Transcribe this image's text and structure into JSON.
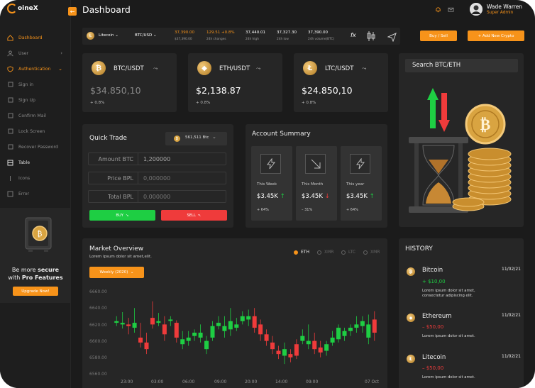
{
  "brand": {
    "name": "oineX"
  },
  "header": {
    "title": "Dashboard",
    "user_name": "Wade Warren",
    "user_role": "Super Admin"
  },
  "sidebar": {
    "items": [
      {
        "label": "Dashboard"
      },
      {
        "label": "User"
      },
      {
        "label": "Authentication"
      },
      {
        "label": "Sign in"
      },
      {
        "label": "Sign Up"
      },
      {
        "label": "Confirm Mail"
      },
      {
        "label": "Lock Screen"
      },
      {
        "label": "Recover Password"
      },
      {
        "label": "Table"
      },
      {
        "label": "Icons"
      },
      {
        "label": "Error"
      }
    ],
    "promo": {
      "line1_pre": "Be more ",
      "line1_strong": "secure",
      "line2_pre": "with ",
      "line2_strong": "Pro Features",
      "button": "Upgrade Now!"
    }
  },
  "ticker": {
    "coin": "Litecoin",
    "pair": "BTC/USD",
    "price_main": "37,390.00",
    "price_sub": "$37,390.00",
    "change_value": "129.51",
    "change_pct": "+0.8%",
    "change_label": "24h changes",
    "high": "37,440.01",
    "high_label": "24h high",
    "low": "37,327.30",
    "low_label": "24h low",
    "volume": "37,390.00",
    "volume_label": "24h volume(BTC)",
    "fx": "fx",
    "buy_sell": "Buy / Sell",
    "add_new": "+ Add New Crypto"
  },
  "coins": [
    {
      "symbol": "₿",
      "pair": "BTC/USDT",
      "price": "$34.850,10",
      "pct": "+ 0.8%",
      "muted": true
    },
    {
      "symbol": "◆",
      "pair": "ETH/USDT",
      "price": "$2,138.87",
      "pct": "+ 0.8%",
      "muted": false
    },
    {
      "symbol": "Ł",
      "pair": "LTC/USDT",
      "price": "$24.850,10",
      "pct": "+ 0.8%",
      "muted": false
    }
  ],
  "quick_trade": {
    "title": "Quick Trade",
    "select_value": "561,511 Btc",
    "rows": [
      {
        "label": "Amount BTC",
        "value": "1,200000"
      },
      {
        "label": "Price BPL",
        "value": "0,000000"
      },
      {
        "label": "Total BPL",
        "value": "0,000000"
      }
    ],
    "buy": "BUY",
    "sell": "SELL"
  },
  "account_summary": {
    "title": "Account Summary",
    "boxes": [
      {
        "label": "This Week",
        "value": "$3.45K",
        "arrow": "↑",
        "pct": "+ 64%"
      },
      {
        "label": "This Month",
        "value": "$3.45K",
        "arrow": "↓",
        "pct": "– 31%"
      },
      {
        "label": "This year",
        "value": "$3.45K",
        "arrow": "↑",
        "pct": "+ 64%"
      }
    ]
  },
  "search_panel": {
    "title": "Search BTC/ETH"
  },
  "market": {
    "title": "Market Overview",
    "subtitle": "Lorem ipsum dolor sit amet,elit.",
    "period": "Weekly (2020)",
    "legend": [
      "ETH",
      "XMR",
      "LTC",
      "XMR"
    ]
  },
  "chart_data": {
    "type": "candlestick",
    "title": "Market Overview",
    "y_ticks": [
      "6660.00",
      "6640.00",
      "6620.00",
      "6600.00",
      "6580.00",
      "6560.00"
    ],
    "x_ticks": [
      "23:00",
      "03:00",
      "06:00",
      "09:00",
      "20:00",
      "14:00",
      "09:00",
      "07 Oct"
    ],
    "ylim": [
      6560,
      6660
    ],
    "up_color": "#1ece43",
    "down_color": "#ef3b3b",
    "candles": [
      {
        "o": 6622,
        "c": 6624,
        "h": 6630,
        "l": 6618
      },
      {
        "o": 6620,
        "c": 6622,
        "h": 6635,
        "l": 6615
      },
      {
        "o": 6620,
        "c": 6618,
        "h": 6628,
        "l": 6608
      },
      {
        "o": 6616,
        "c": 6622,
        "h": 6640,
        "l": 6610
      },
      {
        "o": 6604,
        "c": 6598,
        "h": 6622,
        "l": 6592
      },
      {
        "o": 6598,
        "c": 6590,
        "h": 6610,
        "l": 6584
      },
      {
        "o": 6628,
        "c": 6620,
        "h": 6648,
        "l": 6615
      },
      {
        "o": 6622,
        "c": 6624,
        "h": 6634,
        "l": 6618
      },
      {
        "o": 6620,
        "c": 6608,
        "h": 6630,
        "l": 6600
      },
      {
        "o": 6625,
        "c": 6626,
        "h": 6630,
        "l": 6618
      },
      {
        "o": 6622,
        "c": 6604,
        "h": 6625,
        "l": 6598
      },
      {
        "o": 6596,
        "c": 6602,
        "h": 6612,
        "l": 6590
      },
      {
        "o": 6600,
        "c": 6604,
        "h": 6612,
        "l": 6594
      },
      {
        "o": 6606,
        "c": 6610,
        "h": 6614,
        "l": 6600
      },
      {
        "o": 6604,
        "c": 6610,
        "h": 6620,
        "l": 6598
      },
      {
        "o": 6590,
        "c": 6600,
        "h": 6606,
        "l": 6584
      },
      {
        "o": 6604,
        "c": 6618,
        "h": 6624,
        "l": 6600
      },
      {
        "o": 6618,
        "c": 6622,
        "h": 6630,
        "l": 6614
      },
      {
        "o": 6612,
        "c": 6618,
        "h": 6630,
        "l": 6604
      },
      {
        "o": 6614,
        "c": 6624,
        "h": 6640,
        "l": 6606
      },
      {
        "o": 6616,
        "c": 6620,
        "h": 6628,
        "l": 6612
      },
      {
        "o": 6624,
        "c": 6630,
        "h": 6636,
        "l": 6620
      },
      {
        "o": 6626,
        "c": 6630,
        "h": 6638,
        "l": 6618
      },
      {
        "o": 6630,
        "c": 6616,
        "h": 6640,
        "l": 6610
      },
      {
        "o": 6620,
        "c": 6608,
        "h": 6626,
        "l": 6600
      },
      {
        "o": 6608,
        "c": 6600,
        "h": 6614,
        "l": 6594
      },
      {
        "o": 6598,
        "c": 6590,
        "h": 6606,
        "l": 6584
      },
      {
        "o": 6588,
        "c": 6584,
        "h": 6594,
        "l": 6578
      },
      {
        "o": 6582,
        "c": 6590,
        "h": 6598,
        "l": 6572
      },
      {
        "o": 6584,
        "c": 6580,
        "h": 6590,
        "l": 6574
      },
      {
        "o": 6596,
        "c": 6582,
        "h": 6602,
        "l": 6578
      },
      {
        "o": 6600,
        "c": 6606,
        "h": 6614,
        "l": 6596
      },
      {
        "o": 6596,
        "c": 6600,
        "h": 6620,
        "l": 6590
      },
      {
        "o": 6600,
        "c": 6590,
        "h": 6610,
        "l": 6584
      },
      {
        "o": 6592,
        "c": 6586,
        "h": 6600,
        "l": 6580
      },
      {
        "o": 6588,
        "c": 6596,
        "h": 6600,
        "l": 6582
      },
      {
        "o": 6598,
        "c": 6604,
        "h": 6612,
        "l": 6594
      },
      {
        "o": 6602,
        "c": 6616,
        "h": 6620,
        "l": 6598
      },
      {
        "o": 6606,
        "c": 6612,
        "h": 6616,
        "l": 6600
      },
      {
        "o": 6612,
        "c": 6616,
        "h": 6620,
        "l": 6606
      },
      {
        "o": 6616,
        "c": 6620,
        "h": 6630,
        "l": 6610
      },
      {
        "o": 6618,
        "c": 6624,
        "h": 6630,
        "l": 6610
      },
      {
        "o": 6604,
        "c": 6620,
        "h": 6632,
        "l": 6596
      },
      {
        "o": 6626,
        "c": 6610,
        "h": 6636,
        "l": 6600
      }
    ]
  },
  "history": {
    "title": "HISTORY",
    "items": [
      {
        "symbol": "₿",
        "name": "Bitcoin",
        "date": "11/02/21",
        "amount": "+ $10,00",
        "positive": true,
        "desc": "Lorem ipsum dolor sit amet, consectetur adipiscing elit."
      },
      {
        "symbol": "◆",
        "name": "Ethereum",
        "date": "11/02/21",
        "amount": "– $50,00",
        "positive": false,
        "desc": "Lorem ipsum dolor sit amet."
      },
      {
        "symbol": "Ł",
        "name": "Litecoin",
        "date": "11/02/21",
        "amount": "– $50,00",
        "positive": false,
        "desc": "Lorem ipsum dolor sit amet."
      }
    ]
  },
  "colors": {
    "accent": "#f7931a",
    "up": "#1ece43",
    "down": "#ef3b3b",
    "bg": "#1b1b1b",
    "card": "#262626"
  }
}
